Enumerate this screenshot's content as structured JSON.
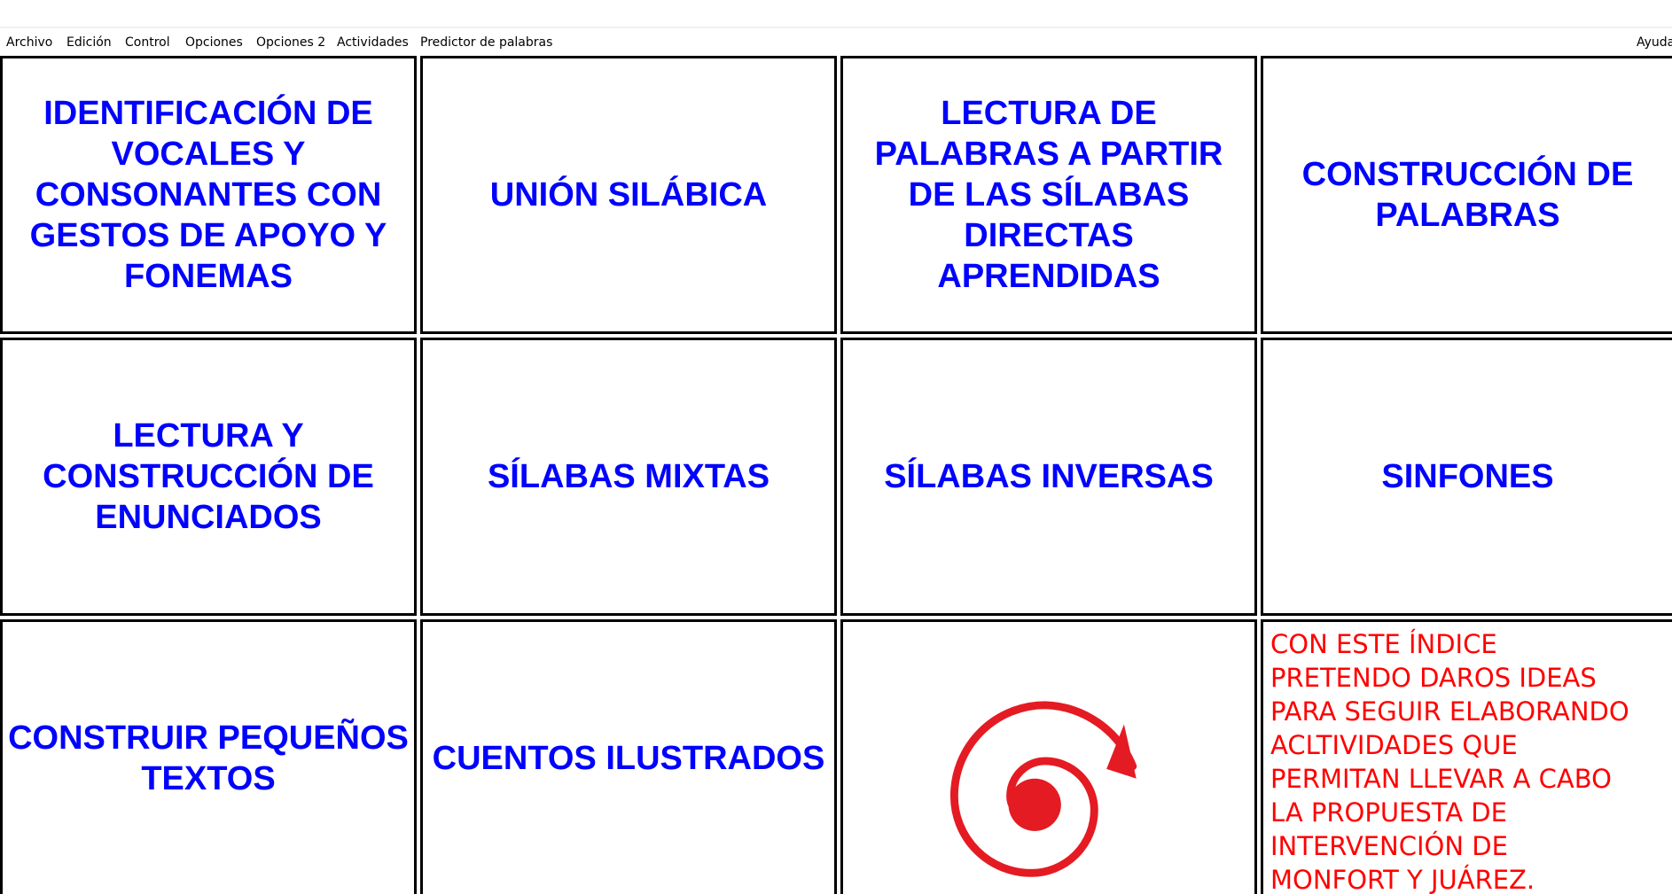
{
  "menu": {
    "items": [
      "Archivo",
      "Edición",
      "Control",
      "Opciones",
      "Opciones 2",
      "Actividades",
      "Predictor de palabras"
    ],
    "help": "Ayuda"
  },
  "colors": {
    "cell_text": "#0000ff",
    "note_text": "#ff0000",
    "spiral": "#e41b23"
  },
  "cells": {
    "r1c1": "IDENTIFICACIÓN DE VOCALES Y CONSONANTES CON GESTOS DE APOYO Y FONEMAS",
    "r1c2": "UNIÓN SILÁBICA",
    "r1c3": "LECTURA DE PALABRAS A PARTIR DE LAS SÍLABAS DIRECTAS APRENDIDAS",
    "r1c4": "CONSTRUCCIÓN DE PALABRAS",
    "r2c1": "LECTURA Y CONSTRUCCIÓN DE ENUNCIADOS",
    "r2c2": "SÍLABAS MIXTAS",
    "r2c3": "SÍLABAS INVERSAS",
    "r2c4": "SINFONES",
    "r3c1": "CONSTRUIR PEQUEÑOS TEXTOS",
    "r3c2": "CUENTOS ILUSTRADOS",
    "r3c3_icon": "spiral-arrow-icon",
    "r3c4": "CON ESTE ÍNDICE\nPRETENDO DAROS IDEAS\nPARA SEGUIR ELABORANDO\nACLTIVIDADES QUE\nPERMITAN LLEVAR A CABO\nLA PROPUESTA DE\nINTERVENCIÓN DE\nMONFORT Y JUÁREZ."
  }
}
